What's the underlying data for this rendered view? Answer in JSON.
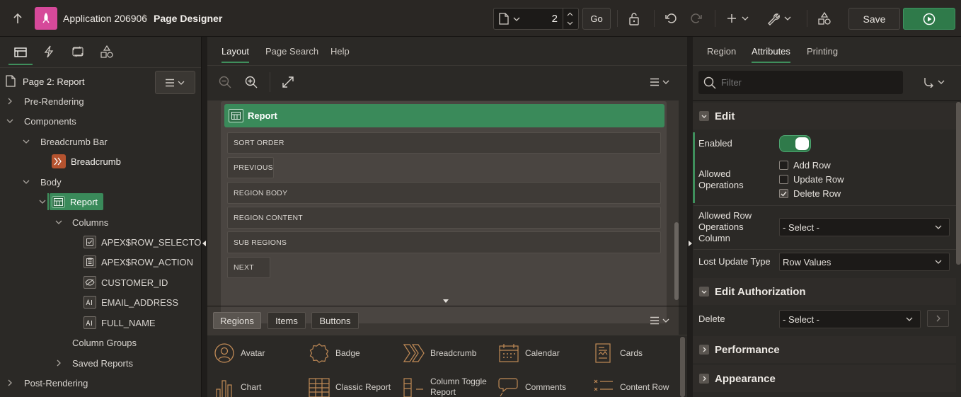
{
  "header": {
    "app_name": "Application 206906",
    "separator": "\\",
    "page_title": "Page Designer",
    "page_number": "2",
    "go_label": "Go",
    "save_label": "Save"
  },
  "left": {
    "page_label": "Page 2: Report",
    "tree": {
      "pre_rendering": "Pre-Rendering",
      "components": "Components",
      "breadcrumb_bar": "Breadcrumb Bar",
      "breadcrumb": "Breadcrumb",
      "body": "Body",
      "report": "Report",
      "columns": "Columns",
      "col1": "APEX$ROW_SELECTOR",
      "col2": "APEX$ROW_ACTION",
      "col3": "CUSTOMER_ID",
      "col4": "EMAIL_ADDRESS",
      "col5": "FULL_NAME",
      "column_groups": "Column Groups",
      "saved_reports": "Saved Reports",
      "post_rendering": "Post-Rendering"
    }
  },
  "center": {
    "tabs": [
      "Layout",
      "Page Search",
      "Help"
    ],
    "region_title": "Report",
    "slots": [
      "SORT ORDER",
      "PREVIOUS",
      "REGION BODY",
      "REGION CONTENT",
      "SUB REGIONS",
      "NEXT"
    ],
    "gallery_tabs": [
      "Regions",
      "Items",
      "Buttons"
    ],
    "gallery": [
      "Avatar",
      "Badge",
      "Breadcrumb",
      "Calendar",
      "Cards",
      "Chart",
      "Classic Report",
      "Column Toggle Report",
      "Comments",
      "Content Row"
    ]
  },
  "right": {
    "tabs": [
      "Region",
      "Attributes",
      "Printing"
    ],
    "filter_placeholder": "Filter",
    "edit_title": "Edit",
    "enabled_label": "Enabled",
    "allowed_ops_label": "Allowed Operations",
    "ops": [
      "Add Row",
      "Update Row",
      "Delete Row"
    ],
    "ops_checked": [
      false,
      false,
      true
    ],
    "row_ops_col_label": "Allowed Row Operations Column",
    "row_ops_col_value": "- Select -",
    "lost_update_label": "Lost Update Type",
    "lost_update_value": "Row Values",
    "edit_auth_title": "Edit Authorization",
    "delete_label": "Delete",
    "delete_value": "- Select -",
    "performance_title": "Performance",
    "appearance_title": "Appearance"
  },
  "colors": {
    "accent_green": "#2f7a4a",
    "region_green": "#3a8a5a",
    "app_icon": "#d6499a",
    "breadcrumb_icon": "#b5532f"
  }
}
